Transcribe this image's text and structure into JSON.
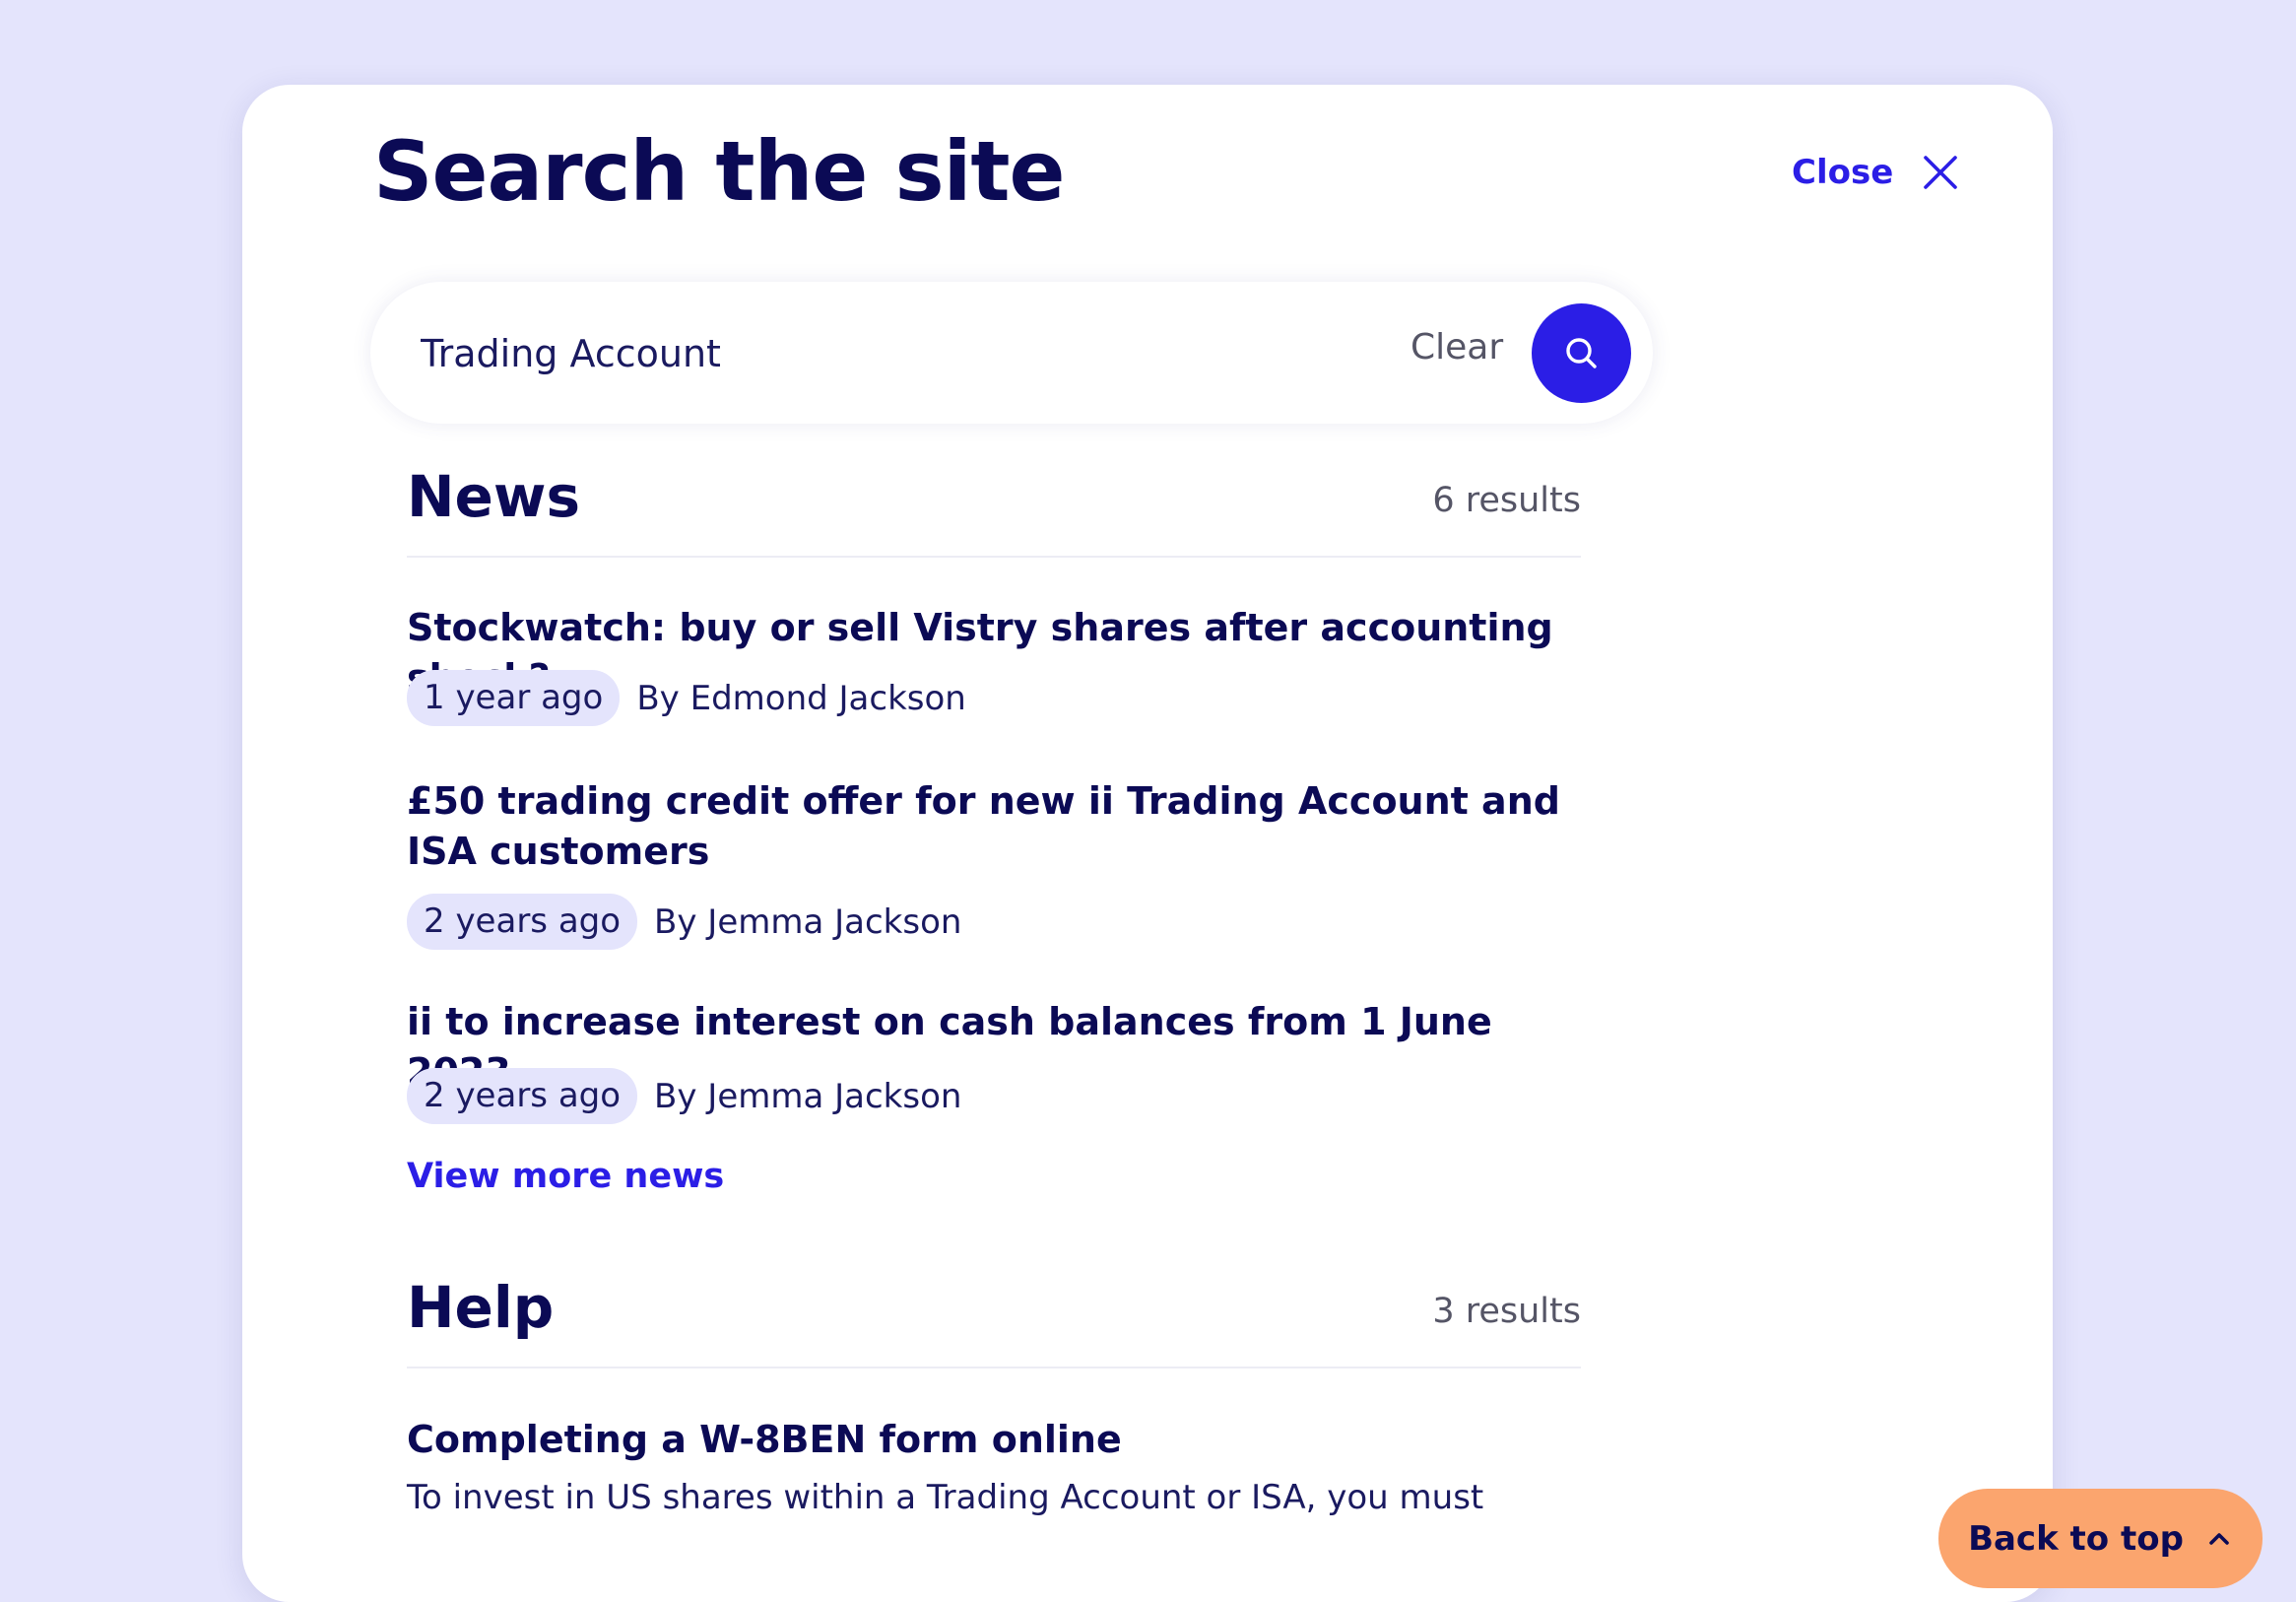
{
  "header": {
    "title": "Search the site",
    "close_label": "Close"
  },
  "search": {
    "value": "Trading Account",
    "clear_label": "Clear"
  },
  "news": {
    "title": "News",
    "count": "6 results",
    "items": [
      {
        "title": "Stockwatch: buy or sell Vistry shares after accounting shock?",
        "age": "1 year ago",
        "author": "By Edmond Jackson"
      },
      {
        "title": "£50 trading credit offer for new ii Trading Account and ISA customers",
        "age": "2 years ago",
        "author": "By Jemma Jackson"
      },
      {
        "title": "ii to increase interest on cash balances from 1 June 2023",
        "age": "2 years ago",
        "author": "By Jemma Jackson"
      }
    ],
    "view_more": "View more news"
  },
  "help": {
    "title": "Help",
    "count": "3 results",
    "items": [
      {
        "title": "Completing a W-8BEN form online",
        "excerpt": "To invest in US shares within a Trading Account or ISA, you must"
      }
    ]
  },
  "back_to_top": {
    "label": "Back to top"
  },
  "colors": {
    "page_bg": "#e4e4fc",
    "accent": "#2b1ee6",
    "heading": "#0b0a55",
    "back_to_top_bg": "#fba56e"
  },
  "icons": {
    "close": "close-icon",
    "search": "search-icon",
    "back_to_top": "chevron-up-icon"
  }
}
